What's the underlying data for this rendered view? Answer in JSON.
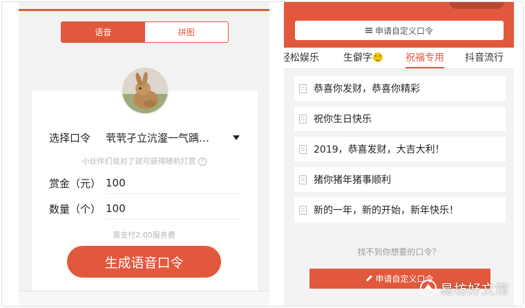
{
  "colors": {
    "accent": "#e2583d",
    "panel_bg": "#f2f2f2",
    "card_bg": "#ffffff"
  },
  "left": {
    "mode_tabs": [
      {
        "label": "语音",
        "active": true
      },
      {
        "label": "拼图",
        "active": false
      }
    ],
    "avatar_icon": "rabbit-photo",
    "fields": {
      "password": {
        "label": "选择口令",
        "value": "茕茕孑立沆瀣一气踽…"
      },
      "hint": "小伙伴们说对了就可获得随机打赏",
      "amount": {
        "label": "赏金（元）",
        "value": "100"
      },
      "count": {
        "label": "数量（个）",
        "value": "100"
      },
      "fee": "需支付2.00服务费"
    },
    "generate_button": "生成语音口令"
  },
  "right": {
    "custom_top": "申请自定义口令",
    "tabs": [
      {
        "label": "轻松娱乐",
        "active": false
      },
      {
        "label": "生僻字",
        "active": false,
        "icon": "smile-emoji"
      },
      {
        "label": "祝福专用",
        "active": true
      },
      {
        "label": "抖音流行",
        "active": false
      }
    ],
    "phrases": [
      "恭喜你发财，恭喜你精彩",
      "祝你生日快乐",
      "2019，恭喜发财，大吉大利！",
      "猪你猪年猪事顺利",
      "新的一年，新的开始，新年快乐！"
    ],
    "not_found": "找不到你想要的口令？",
    "custom_bottom": "申请自定义口令"
  },
  "watermark": "易坊好文馆"
}
